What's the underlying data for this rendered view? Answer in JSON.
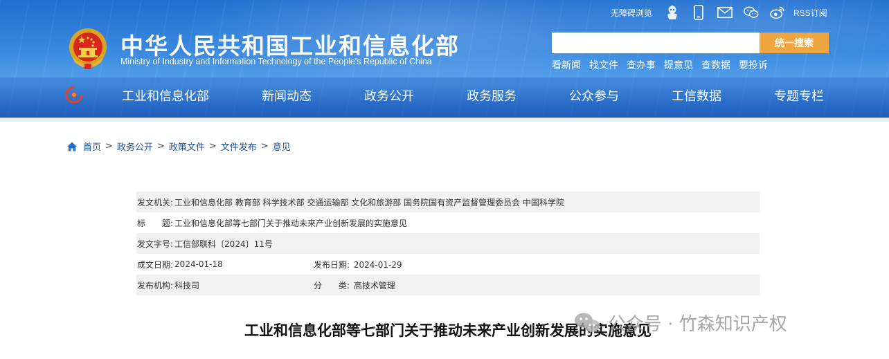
{
  "header": {
    "site_name_cn": "中华人民共和国工业和信息化部",
    "site_name_en": "Ministry of Industry and Information Technology of the People's Republic of China",
    "top_links": {
      "accessible_label": "无障碍浏览",
      "rss_label": "RSS订阅",
      "icons": [
        "robot-assistant-icon",
        "mobile-icon",
        "mail-icon",
        "wechat-icon",
        "weibo-icon"
      ]
    },
    "search": {
      "placeholder": "",
      "button_label": "统一搜索"
    },
    "quick_links": [
      "看新闻",
      "找文件",
      "查办事",
      "提意见",
      "查数据",
      "要投诉"
    ],
    "nav": [
      "工业和信息化部",
      "新闻动态",
      "政务公开",
      "政务服务",
      "公众参与",
      "工信数据",
      "专题专栏"
    ]
  },
  "breadcrumb": {
    "items": [
      "首页",
      "政务公开",
      "政策文件",
      "文件发布",
      "意见"
    ],
    "separator": ">"
  },
  "document_info": {
    "issuer_label": "发文机关:",
    "issuer_value": "工业和信息化部 教育部 科学技术部 交通运输部 文化和旅游部 国务院国有资产监督管理委员会 中国科学院",
    "title_label": "标　　题:",
    "title_value": "工业和信息化部等七部门关于推动未来产业创新发展的实施意见",
    "doc_number_label": "发文字号:",
    "doc_number_value": "工信部联科〔2024〕11号",
    "written_date_label": "成文日期:",
    "written_date_value": "2024-01-18",
    "publish_date_label": "发布日期:",
    "publish_date_value": "2024-01-29",
    "publisher_label": "发布机构:",
    "publisher_value": "科技司",
    "category_label": "分　　类:",
    "category_value": "高技术管理"
  },
  "article": {
    "title": "工业和信息化部等七部门关于推动未来产业创新发展的实施意见"
  },
  "watermark": {
    "text": "公众号 · 竹森知识产权"
  },
  "colors": {
    "header_blue": "#2f7fd8",
    "search_button": "#f0a640",
    "breadcrumb_link": "#1a4f9c",
    "table_gray": "#f1f1f1"
  }
}
